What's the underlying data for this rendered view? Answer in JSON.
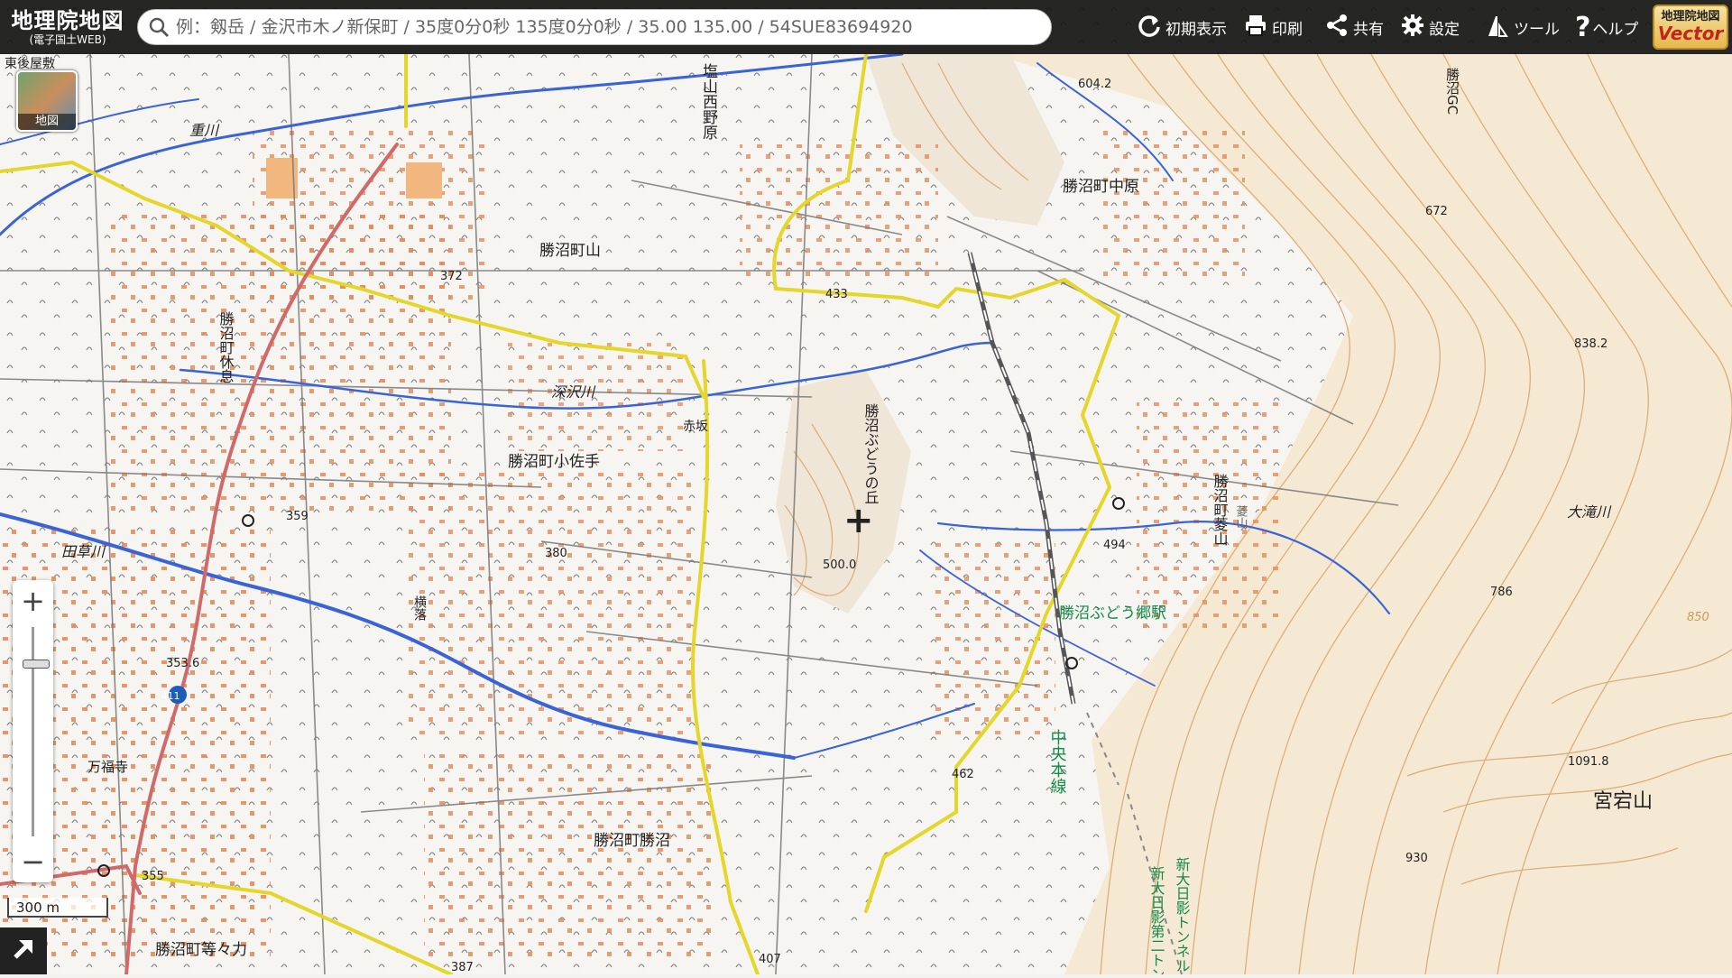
{
  "header": {
    "logo_title": "地理院地図",
    "logo_subtitle": "(電子国土WEB)",
    "search_placeholder": "例：剱岳 / 金沢市木ノ新保町 / 35度0分0秒 135度0分0秒 / 35.00 135.00 / 54SUE83694920",
    "buttons": {
      "reset": "初期表示",
      "print": "印刷",
      "share": "共有",
      "settings": "設定",
      "tools": "ツール",
      "help": "ヘルプ"
    },
    "vector_line1": "地理院地図",
    "vector_line2": "Vector"
  },
  "layer_button": {
    "label": "地図"
  },
  "zoom": {
    "in": "+",
    "out": "−"
  },
  "scale_bar": {
    "label": "300 m"
  },
  "map_labels": {
    "place": [
      "勝沼町山",
      "勝沼町中原",
      "勝沼町小佐手",
      "勝沼町勝沼",
      "勝沼町等々力",
      "万福寺",
      "横落",
      "赤坂",
      "宮宕山",
      "塩山西野原",
      "勝沼町休息",
      "勝沼ぶどうの丘",
      "勝沼町菱山",
      "東後屋敷",
      "勝沼GC",
      "菱山"
    ],
    "river": [
      "重川",
      "田草川",
      "大滝川",
      "深沢川"
    ],
    "station": "勝沼ぶどう郷駅",
    "railway": "中央本線",
    "tunnel": "新大日影トンネル",
    "tunnel2": "新大日影第二トンネル",
    "route_number": "411",
    "elevations": [
      "604.2",
      "672",
      "838.2",
      "786",
      "1091.8",
      "930",
      "500.0",
      "494",
      "462",
      "372",
      "359",
      "353.6",
      "380",
      "433",
      "355",
      "407",
      "387",
      "850"
    ]
  },
  "colors": {
    "header_bg": "#141414",
    "river": "#3a63d8",
    "road_yellow": "#e4d62a",
    "road_red": "#d06a6a",
    "building": "#e88a5a",
    "contour": "#d8a970",
    "railway": "#555555",
    "station_text": "#138a4a"
  }
}
